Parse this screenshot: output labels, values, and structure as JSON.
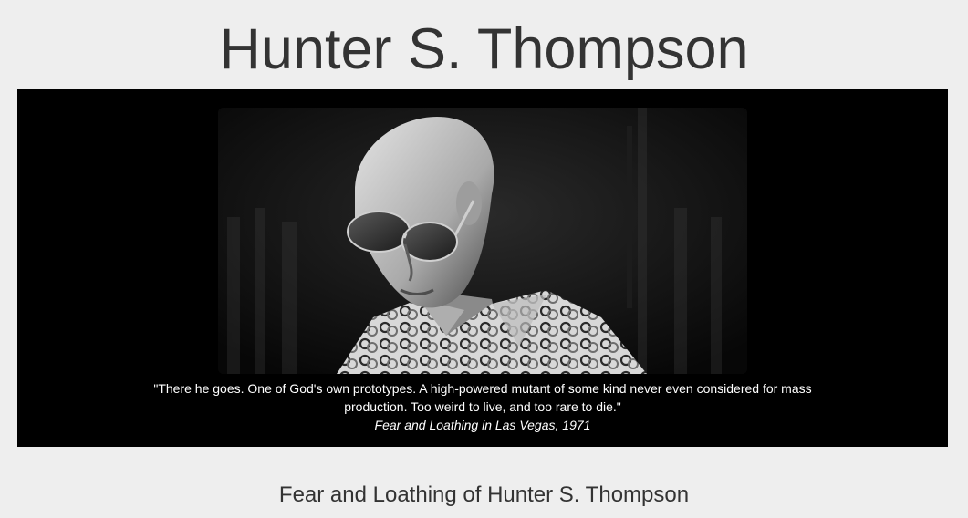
{
  "page": {
    "title": "Hunter S. Thompson"
  },
  "hero": {
    "image_subject": "Black and white portrait of Hunter S. Thompson wearing aviator sunglasses and a patterned shirt",
    "quote": "\"There he goes. One of God's own prototypes. A high-powered mutant of some kind never even considered for mass production. Too weird to live, and too rare to die.\"",
    "source": "Fear and Loathing in Las Vegas, 1971"
  },
  "section": {
    "heading": "Fear and Loathing of Hunter S. Thompson"
  },
  "colors": {
    "page_background": "#eeeeee",
    "hero_background": "#000000",
    "text": "#333333",
    "caption_text": "#ffffff"
  }
}
